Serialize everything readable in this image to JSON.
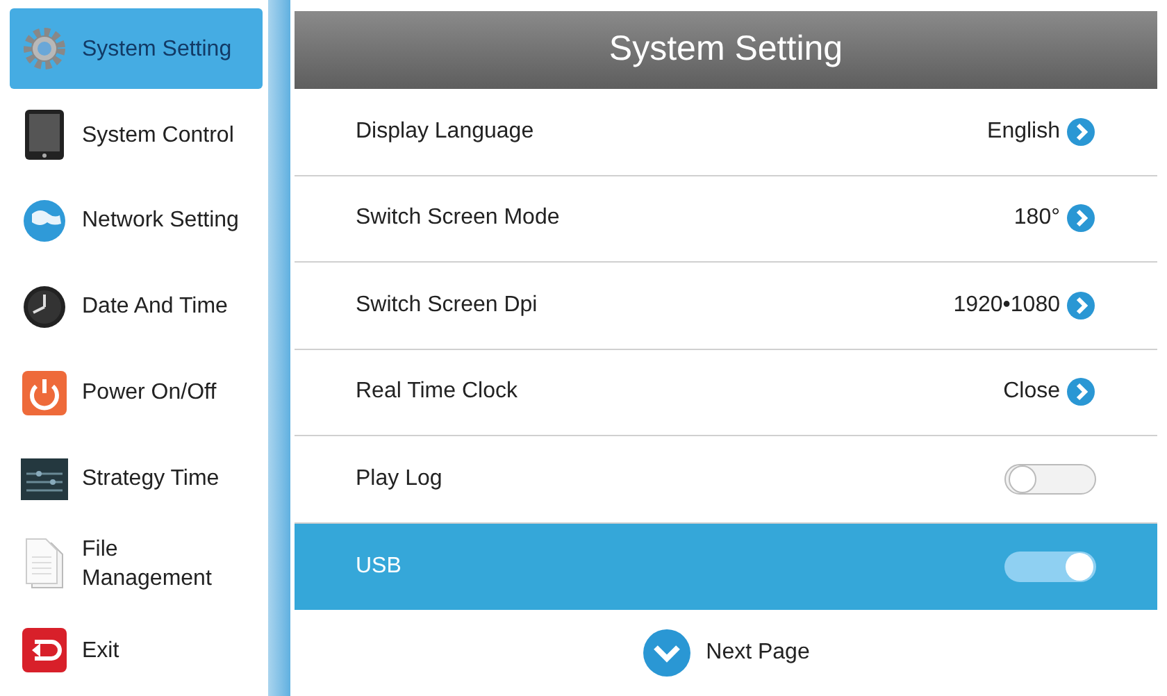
{
  "sidebar": {
    "items": [
      {
        "label": "System Setting",
        "selected": true
      },
      {
        "label": "System Control",
        "selected": false
      },
      {
        "label": "Network Setting",
        "selected": false
      },
      {
        "label": "Date And Time",
        "selected": false
      },
      {
        "label": "Power On/Off",
        "selected": false
      },
      {
        "label": "Strategy Time",
        "selected": false
      },
      {
        "label": "File Management",
        "selected": false
      },
      {
        "label": "Exit",
        "selected": false
      }
    ]
  },
  "panel": {
    "title": "System Setting",
    "rows": [
      {
        "kind": "select",
        "label": "Display Language",
        "value": "English",
        "selected": false
      },
      {
        "kind": "select",
        "label": "Switch Screen Mode",
        "value": "180°",
        "selected": false
      },
      {
        "kind": "select",
        "label": "Switch Screen Dpi",
        "value": "1920•1080",
        "selected": false
      },
      {
        "kind": "select",
        "label": "Real Time Clock",
        "value": "Close",
        "selected": false
      },
      {
        "kind": "toggle",
        "label": "Play Log",
        "on": false,
        "selected": false
      },
      {
        "kind": "toggle",
        "label": "USB",
        "on": true,
        "selected": true
      }
    ],
    "next_page": "Next Page"
  }
}
